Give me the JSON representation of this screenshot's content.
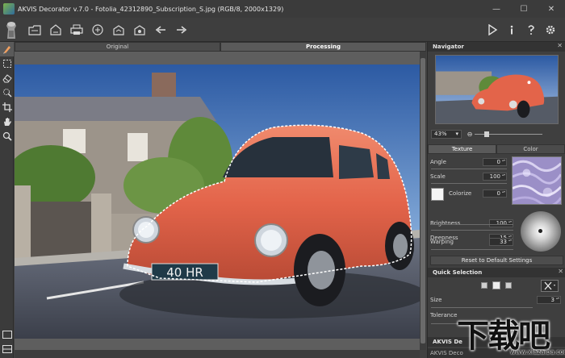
{
  "window": {
    "title": "AKVIS Decorator v.7.0 - Fotolia_42312890_Subscription_S.jpg (RGB/8, 2000x1329)",
    "minimize": "—",
    "maximize": "☐",
    "close": "✕"
  },
  "toolbar": {
    "left_icons": [
      "open-icon",
      "save-icon",
      "print-icon",
      "share-icon",
      "batch-icon",
      "plugin-icon",
      "undo-icon",
      "redo-icon"
    ],
    "right_icons": [
      "run-icon",
      "info-icon",
      "help-icon",
      "settings-icon"
    ]
  },
  "tools": [
    "decorate-brush-icon",
    "rect-selection-icon",
    "eraser-icon",
    "quick-selection-icon",
    "crop-icon",
    "hand-icon",
    "zoom-icon"
  ],
  "tabs": {
    "original": "Original",
    "processing": "Processing"
  },
  "navigator": {
    "title": "Navigator",
    "zoom": "43%"
  },
  "settings": {
    "texture_tab": "Texture",
    "color_tab": "Color",
    "angle_label": "Angle",
    "angle_value": "0",
    "scale_label": "Scale",
    "scale_value": "100",
    "colorize_label": "Colorize",
    "colorize_value": "0",
    "brightness_label": "Brightness",
    "brightness_value": "100",
    "deepness_label": "Deepness",
    "deepness_value": "15",
    "warping_label": "Warping",
    "warping_value": "33",
    "reset_label": "Reset to Default Settings"
  },
  "quick_selection": {
    "title": "Quick Selection",
    "size_label": "Size",
    "size_value": "3",
    "tolerance_label": "Tolerance"
  },
  "bottom": {
    "head_label": "AKVIS De",
    "strip_label": "AKVIS Deco"
  },
  "watermark": {
    "text": "下载吧",
    "url": "www.xiazaiba.com"
  },
  "colors": {
    "car": "#e3644a",
    "sky_top": "#2f5ea6",
    "panel": "#3f3f3f"
  }
}
